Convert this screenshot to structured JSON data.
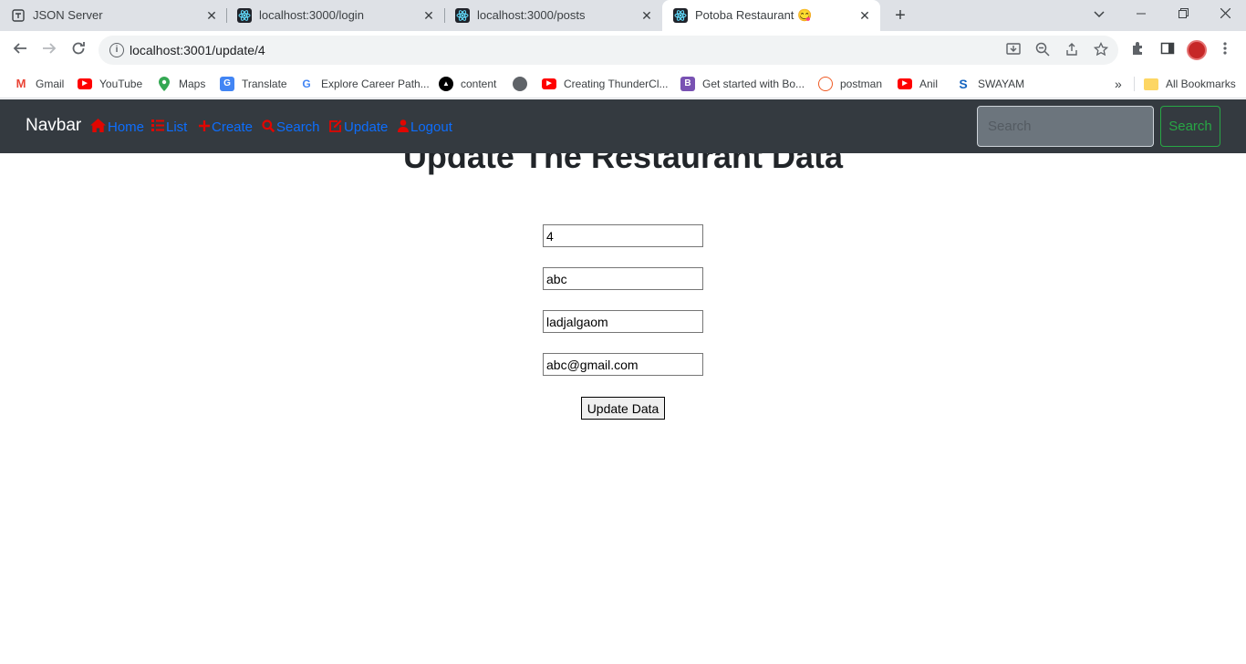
{
  "browser": {
    "tabs": [
      {
        "title": "JSON Server",
        "icon": "json-server-icon"
      },
      {
        "title": "localhost:3000/login",
        "icon": "react-icon"
      },
      {
        "title": "localhost:3000/posts",
        "icon": "react-icon"
      },
      {
        "title": "Potoba Restaurant 😋",
        "icon": "react-icon",
        "active": true
      }
    ],
    "url": "localhost:3001/update/4",
    "bookmarks": [
      {
        "label": "Gmail",
        "icon": "gmail-icon",
        "color": "#ea4335"
      },
      {
        "label": "YouTube",
        "icon": "youtube-icon",
        "color": "#ff0000"
      },
      {
        "label": "Maps",
        "icon": "maps-icon",
        "color": "#34a853"
      },
      {
        "label": "Translate",
        "icon": "translate-icon",
        "color": "#4285f4"
      },
      {
        "label": "Explore Career Path...",
        "icon": "google-icon",
        "color": "#4285f4"
      },
      {
        "label": "content",
        "icon": "triangle-icon",
        "color": "#000000"
      },
      {
        "label": "",
        "icon": "globe-icon",
        "color": "#5f6368"
      },
      {
        "label": "Creating ThunderCl...",
        "icon": "youtube-icon",
        "color": "#ff0000"
      },
      {
        "label": "Get started with Bo...",
        "icon": "bootstrap-icon",
        "color": "#7952b3"
      },
      {
        "label": "postman",
        "icon": "postman-icon",
        "color": "#ef5b25"
      },
      {
        "label": "Anil",
        "icon": "youtube-icon",
        "color": "#ff0000"
      },
      {
        "label": "SWAYAM",
        "icon": "swayam-icon",
        "color": "#1565c0"
      }
    ],
    "more_bookmarks": "»",
    "all_bookmarks": "All Bookmarks"
  },
  "navbar": {
    "brand": "Navbar",
    "links": [
      {
        "label": "Home",
        "icon": "home-icon"
      },
      {
        "label": "List",
        "icon": "list-icon"
      },
      {
        "label": "Create",
        "icon": "plus-icon"
      },
      {
        "label": "Search",
        "icon": "search-icon"
      },
      {
        "label": "Update",
        "icon": "edit-icon"
      },
      {
        "label": "Logout",
        "icon": "user-icon"
      }
    ],
    "search_placeholder": "Search",
    "search_button": "Search",
    "accent": "#0d6efd",
    "icon_color": "#e10600"
  },
  "form": {
    "title": "Update The Restaurant Data",
    "fields": [
      "4",
      "abc",
      "ladjalgaom",
      "abc@gmail.com"
    ],
    "submit": "Update Data"
  }
}
